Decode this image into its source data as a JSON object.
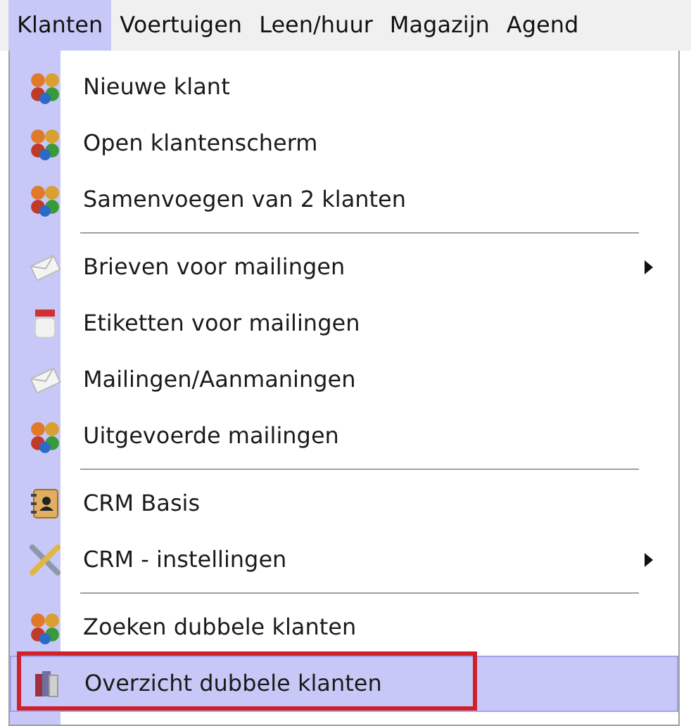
{
  "menubar": [
    {
      "label": "Klanten",
      "selected": true
    },
    {
      "label": "Voertuigen",
      "selected": false
    },
    {
      "label": "Leen/huur",
      "selected": false
    },
    {
      "label": "Magazijn",
      "selected": false
    },
    {
      "label": "Agend",
      "selected": false
    }
  ],
  "menu": [
    {
      "kind": "item",
      "label": "Nieuwe klant",
      "submenu": false,
      "selected": false,
      "annotated": false
    },
    {
      "kind": "item",
      "label": "Open klantenscherm",
      "submenu": false,
      "selected": false,
      "annotated": false
    },
    {
      "kind": "item",
      "label": "Samenvoegen van 2 klanten",
      "submenu": false,
      "selected": false,
      "annotated": false
    },
    {
      "kind": "separator"
    },
    {
      "kind": "item",
      "label": "Brieven voor mailingen",
      "submenu": true,
      "selected": false,
      "annotated": false
    },
    {
      "kind": "item",
      "label": "Etiketten voor mailingen",
      "submenu": false,
      "selected": false,
      "annotated": false
    },
    {
      "kind": "item",
      "label": "Mailingen/Aanmaningen",
      "submenu": false,
      "selected": false,
      "annotated": false
    },
    {
      "kind": "item",
      "label": "Uitgevoerde mailingen",
      "submenu": false,
      "selected": false,
      "annotated": false
    },
    {
      "kind": "separator"
    },
    {
      "kind": "item",
      "label": "CRM Basis",
      "submenu": false,
      "selected": false,
      "annotated": false
    },
    {
      "kind": "item",
      "label": "CRM - instellingen",
      "submenu": true,
      "selected": false,
      "annotated": false
    },
    {
      "kind": "separator"
    },
    {
      "kind": "item",
      "label": "Zoeken dubbele klanten",
      "submenu": false,
      "selected": false,
      "annotated": false
    },
    {
      "kind": "item",
      "label": "Overzicht dubbele klanten",
      "submenu": false,
      "selected": true,
      "annotated": true
    }
  ]
}
